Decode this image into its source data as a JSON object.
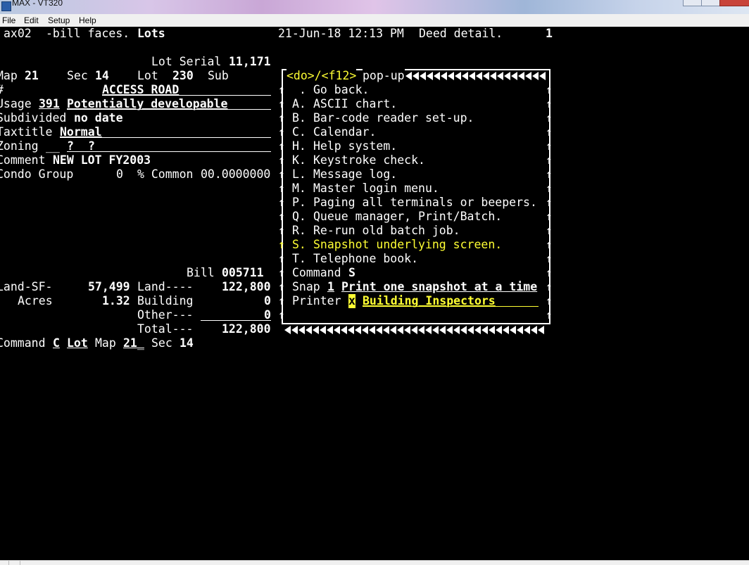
{
  "window": {
    "title": "MAX - VT320"
  },
  "menu": [
    "File",
    "Edit",
    "Setup",
    "Help"
  ],
  "screen": {
    "program": "ax02",
    "subtitle": "-bill faces.",
    "module": "Lots",
    "datetime": "21-Jun-18 12:13 PM",
    "view": "Deed detail.",
    "page": "1",
    "lot_serial_label": "Lot Serial",
    "lot_serial": "11,171",
    "map_label": "Map",
    "map": "21",
    "sec_label": "Sec",
    "sec": "14",
    "lot_label": "Lot",
    "lot": "230",
    "sub_label": "Sub",
    "street_mark": "#",
    "street": "ACCESS ROAD",
    "usage_label": "Usage",
    "usage_code": "391",
    "usage_desc": "Potentially developable",
    "subdivided_label": "Subdivided",
    "subdivided": "no date",
    "taxtitle_label": "Taxtitle",
    "taxtitle": "Normal",
    "zoning_label": "Zoning",
    "zoning_blank": "__",
    "zoning_q1": "?",
    "zoning_q2": "?",
    "comment_label": "Comment",
    "comment": "NEW LOT FY2003",
    "condo_label": "Condo Group",
    "condo_group": "0",
    "common_label": "% Common",
    "common": "00.0000000",
    "bill_label": "Bill",
    "bill": "005711",
    "landsf_label": "Land-SF-",
    "landsf": "57,499",
    "acres_label": "Acres",
    "acres": "1.32",
    "land_label": "Land----",
    "land": "122,800",
    "building_label": "Building",
    "building": "0",
    "other_label": "Other---",
    "other": "0",
    "total_label": "Total---",
    "total": "122,800",
    "command_label": "Command",
    "command": "C",
    "cmd_module": "Lot",
    "cmd_map_label": "Map",
    "cmd_map": "21",
    "cmd_map_pad": "_",
    "cmd_sec_label": "Sec",
    "cmd_sec": "14"
  },
  "popup": {
    "header_key": "<do>/<f12>",
    "header_label": "pop-up",
    "items": [
      {
        "key": ".",
        "label": "Go back."
      },
      {
        "key": "A.",
        "label": "ASCII chart."
      },
      {
        "key": "B.",
        "label": "Bar-code reader set-up."
      },
      {
        "key": "C.",
        "label": "Calendar."
      },
      {
        "key": "H.",
        "label": "Help system."
      },
      {
        "key": "K.",
        "label": "Keystroke check."
      },
      {
        "key": "L.",
        "label": "Message log."
      },
      {
        "key": "M.",
        "label": "Master login menu."
      },
      {
        "key": "P.",
        "label": "Paging all terminals or beepers."
      },
      {
        "key": "Q.",
        "label": "Queue manager, Print/Batch."
      },
      {
        "key": "R.",
        "label": "Re-run old batch job."
      },
      {
        "key": "S.",
        "label": "Snapshot underlying screen."
      },
      {
        "key": "T.",
        "label": "Telephone book."
      }
    ],
    "selected_key": "S.",
    "command_label": "Command",
    "command": "S",
    "snap_label": "Snap",
    "snap": "1",
    "snap_desc": "Print one snapshot at a time",
    "printer_label": "Printer",
    "printer_code": "x",
    "printer_name": "Building Inspectors"
  },
  "colors": {
    "background": "#000000",
    "text": "#ffffff",
    "highlight": "#ffff33"
  }
}
